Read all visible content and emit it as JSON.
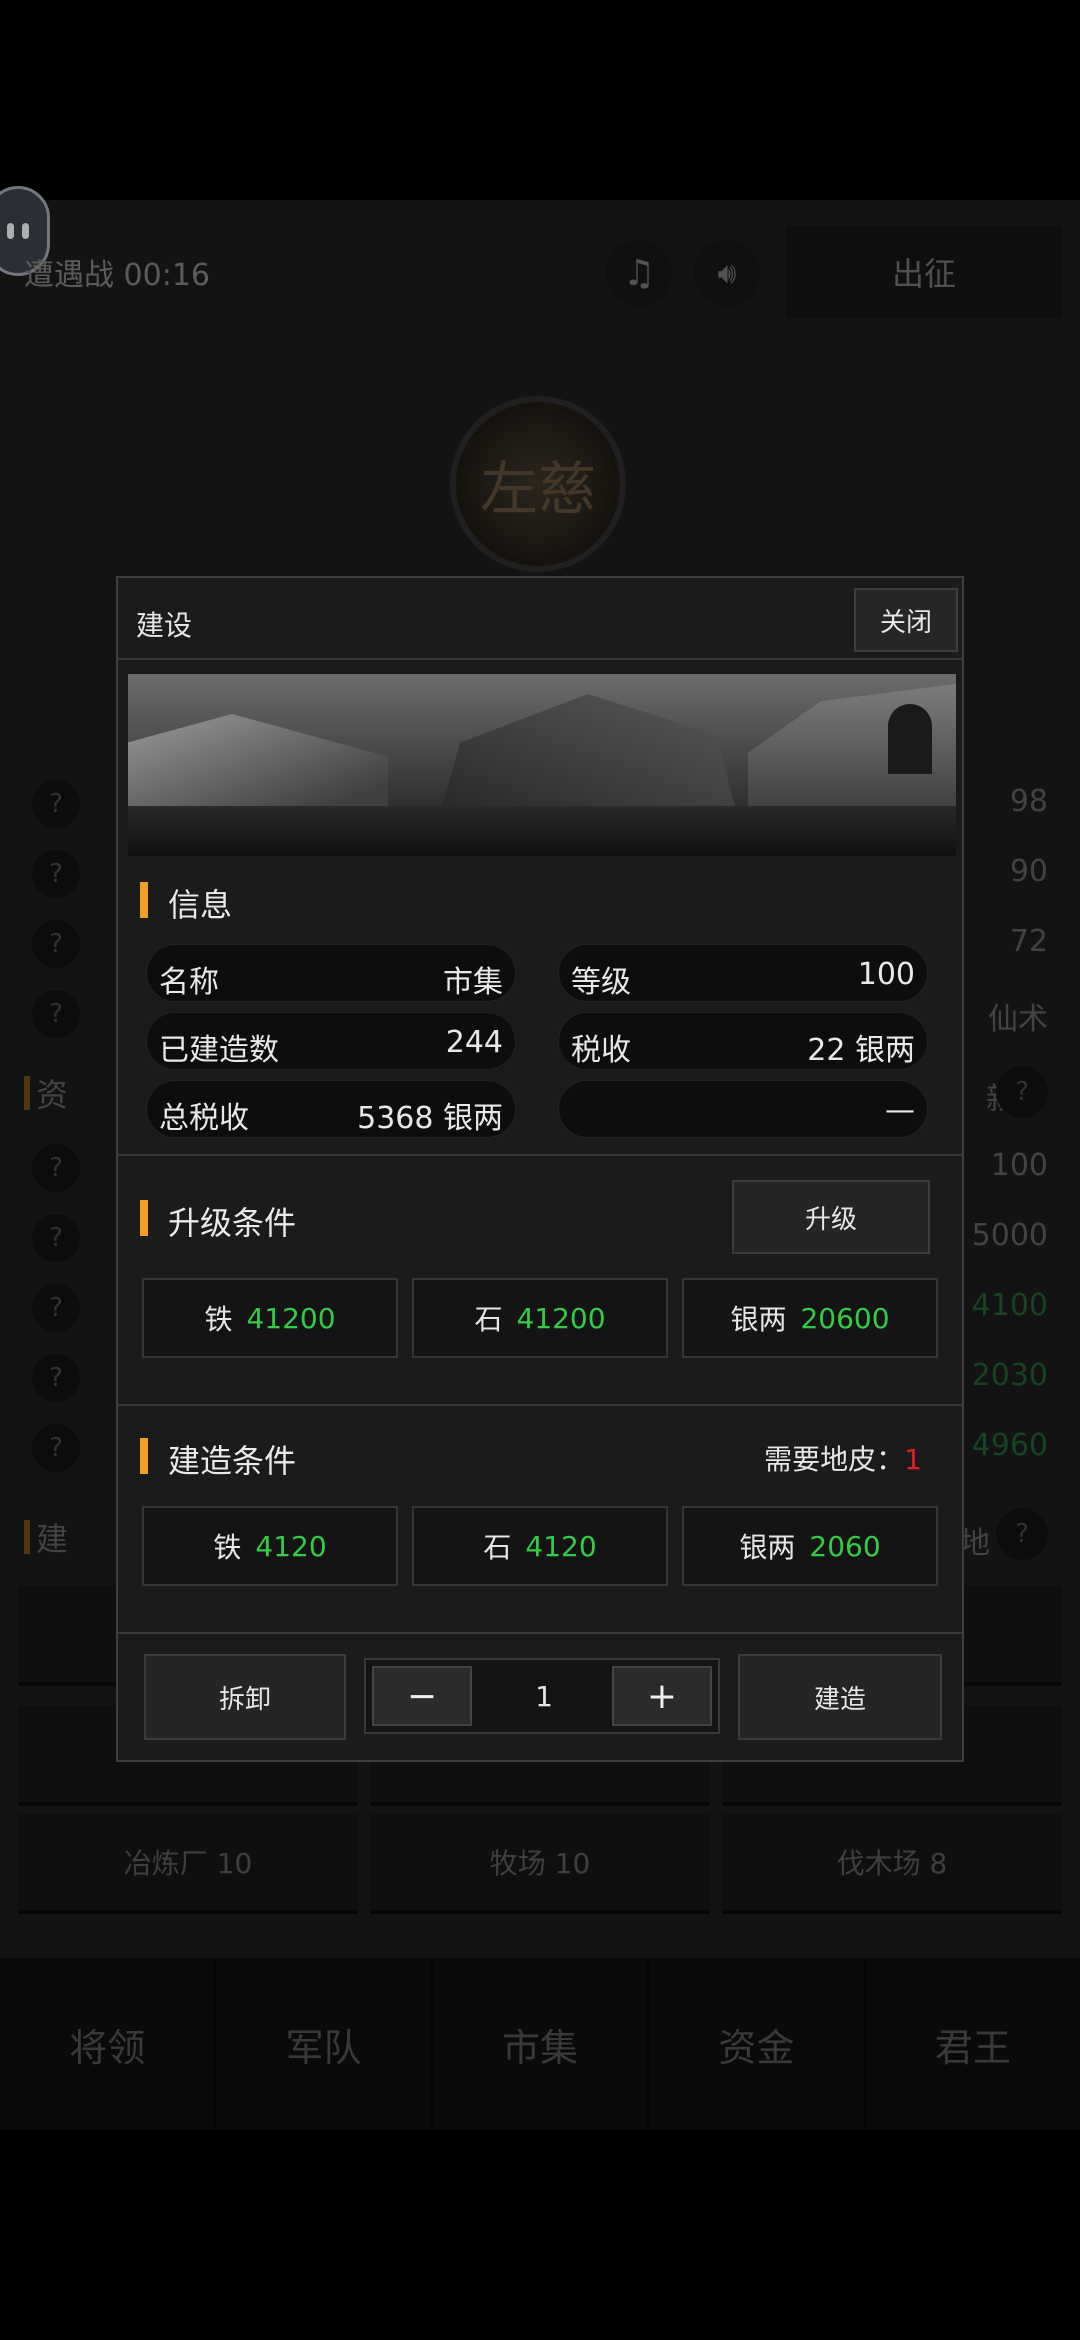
{
  "topbar": {
    "battle_label": "遭遇战 00:16",
    "music_icon": "music-note-icon",
    "sound_icon": "speaker-icon",
    "expedition_label": "出征"
  },
  "emblem": {
    "text": "左慈"
  },
  "background_rows": [
    {
      "q": "?",
      "value": "98",
      "green": false
    },
    {
      "q": "?",
      "value": "90",
      "green": false
    },
    {
      "q": "?",
      "value": "72",
      "green": false
    },
    {
      "q": "?",
      "value": "仙术",
      "green": false
    }
  ],
  "background_section_resources": {
    "title": "资",
    "right": "新",
    "help": "?"
  },
  "background_resource_rows": [
    {
      "q": "?",
      "value": "100",
      "green": false
    },
    {
      "q": "?",
      "value": "5000",
      "green": false
    },
    {
      "q": "?",
      "value": "4100",
      "green": true
    },
    {
      "q": "?",
      "value": "2030",
      "green": true
    },
    {
      "q": "?",
      "value": "4960",
      "green": true
    }
  ],
  "background_section_build": {
    "title": "建",
    "right": "地",
    "help": "?"
  },
  "background_tiles": [
    "冶炼厂 10",
    "牧场 10",
    "伐木场 8"
  ],
  "bottom_nav": [
    "将领",
    "军队",
    "市集",
    "资金",
    "君王"
  ],
  "modal": {
    "title": "建设",
    "close_label": "关闭",
    "info_title": "信息",
    "info": {
      "name_key": "名称",
      "name_val": "市集",
      "level_key": "等级",
      "level_val": "100",
      "built_key": "已建造数",
      "built_val": "244",
      "tax_key": "税收",
      "tax_val": "22 银两",
      "total_tax_key": "总税收",
      "total_tax_val": "5368 银两",
      "empty_val": "—"
    },
    "upgrade_title": "升级条件",
    "upgrade_button": "升级",
    "upgrade_costs": [
      {
        "name": "铁",
        "amount": "41200"
      },
      {
        "name": "石",
        "amount": "41200"
      },
      {
        "name": "银两",
        "amount": "20600"
      }
    ],
    "build_title": "建造条件",
    "need_land_label": "需要地皮：",
    "need_land_value": "1",
    "build_costs": [
      {
        "name": "铁",
        "amount": "4120"
      },
      {
        "name": "石",
        "amount": "4120"
      },
      {
        "name": "银两",
        "amount": "2060"
      }
    ],
    "demolish_button": "拆卸",
    "minus": "−",
    "quantity": "1",
    "plus": "+",
    "build_button": "建造"
  }
}
